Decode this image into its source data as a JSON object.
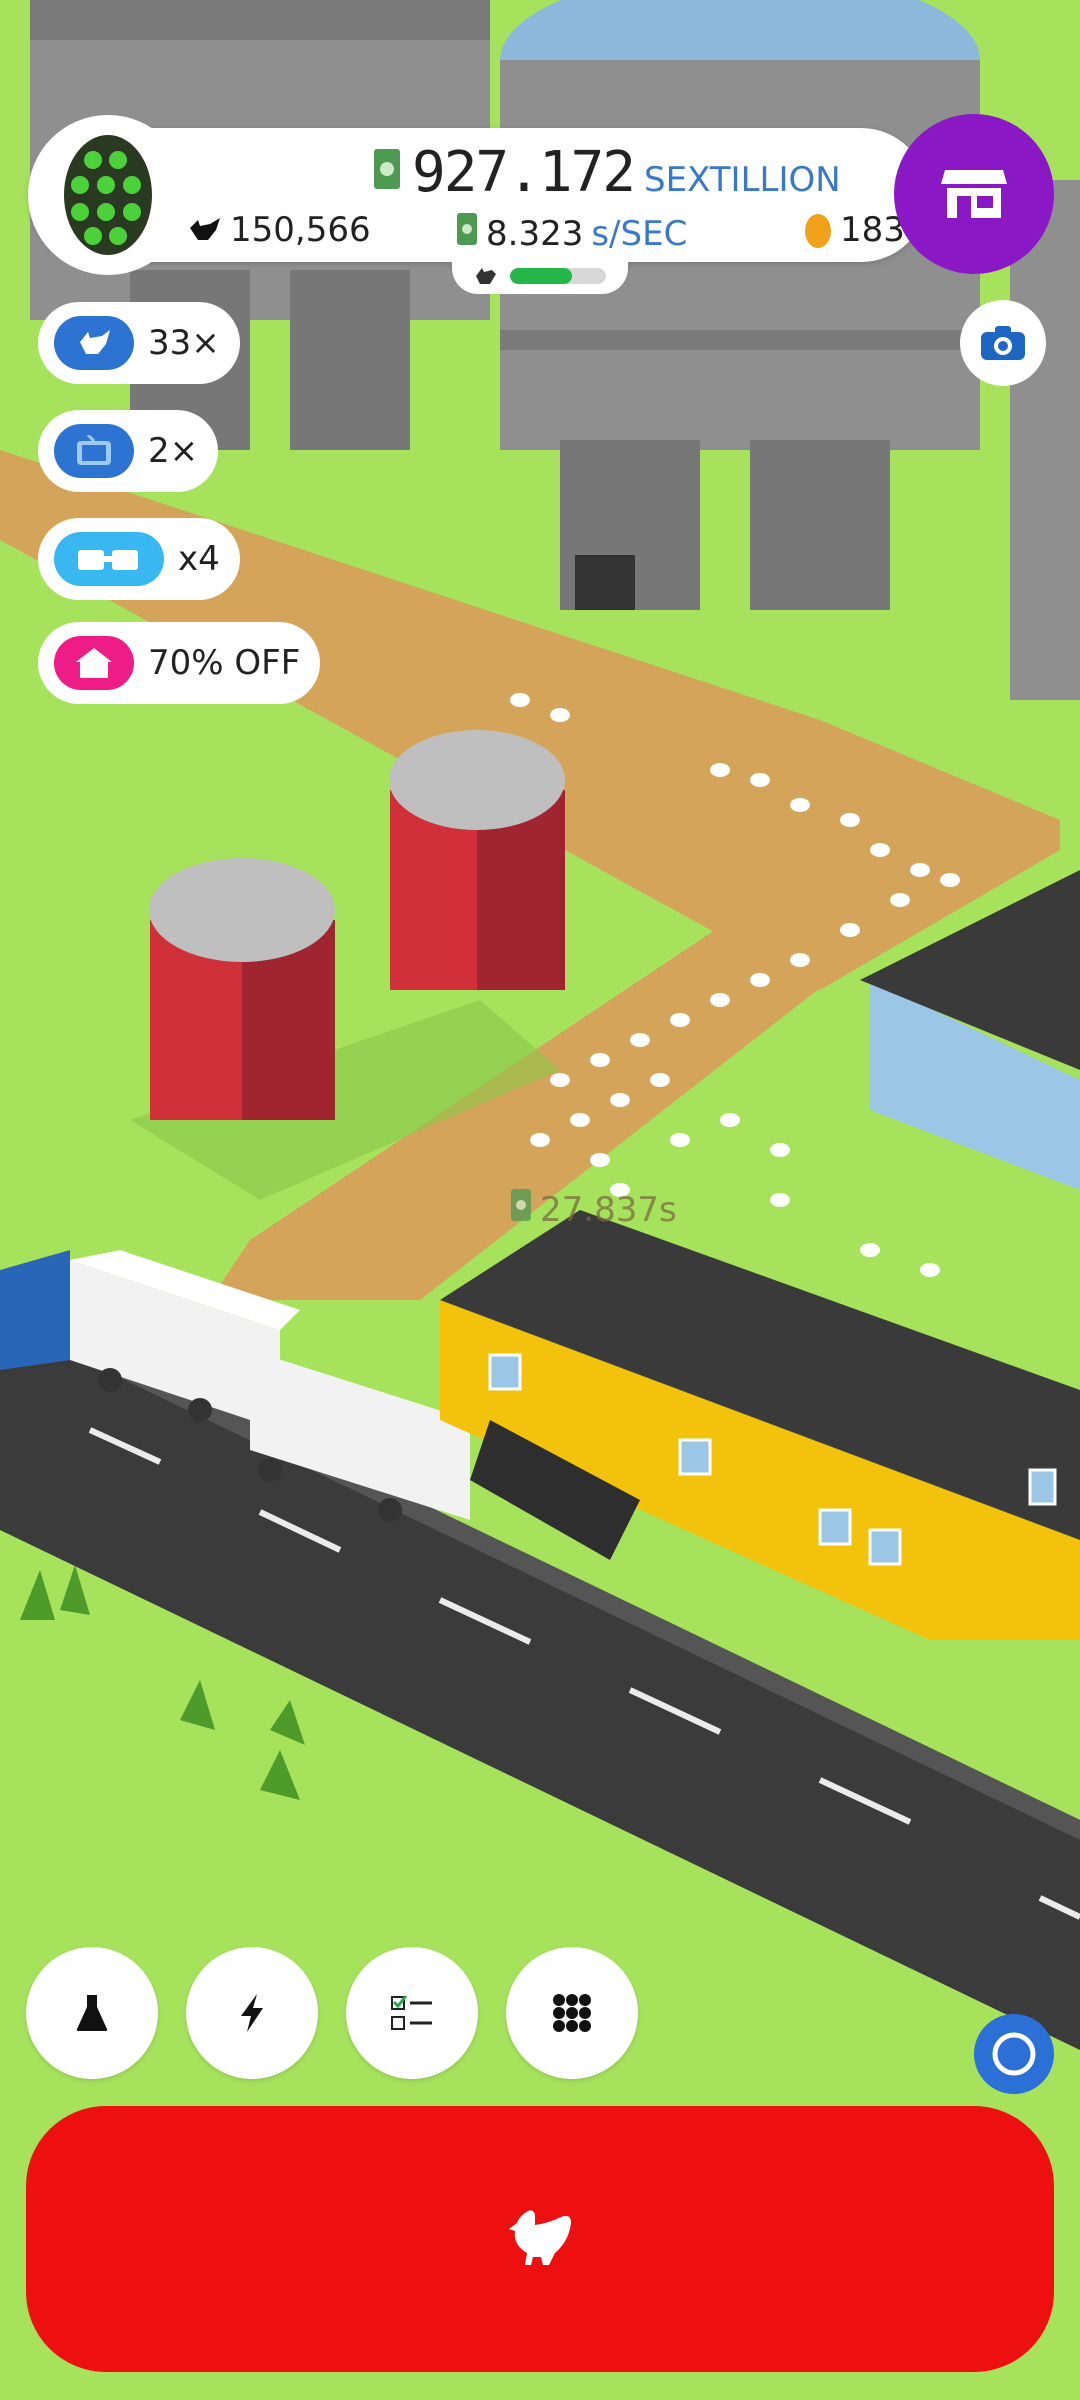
{
  "hud": {
    "money_value": "927.172",
    "money_unit": "SEXTILLION",
    "chicken_count": "150,566",
    "rate_value": "8.323",
    "rate_unit": "s/SEC",
    "golden_eggs": "183",
    "hatch_progress": 0.65
  },
  "boosts": [
    {
      "label": "33×",
      "color": "#2d74d2"
    },
    {
      "label": "2×",
      "color": "#2d74d2"
    },
    {
      "label": "x4",
      "color": "#39b7f0"
    },
    {
      "label": "70% OFF",
      "color": "#ee1c86"
    }
  ],
  "world": {
    "floating_rate": "27.837s"
  },
  "bottom_bar": {
    "buttons": [
      "flask-icon",
      "lightning-icon",
      "checklist-icon",
      "grid-icon"
    ],
    "main_button_icon": "chicken-icon"
  },
  "colors": {
    "grass": "#a6e25c",
    "shop": "#8a18c4",
    "hatch_button": "#ee1010",
    "road": "#3b3b3b"
  }
}
